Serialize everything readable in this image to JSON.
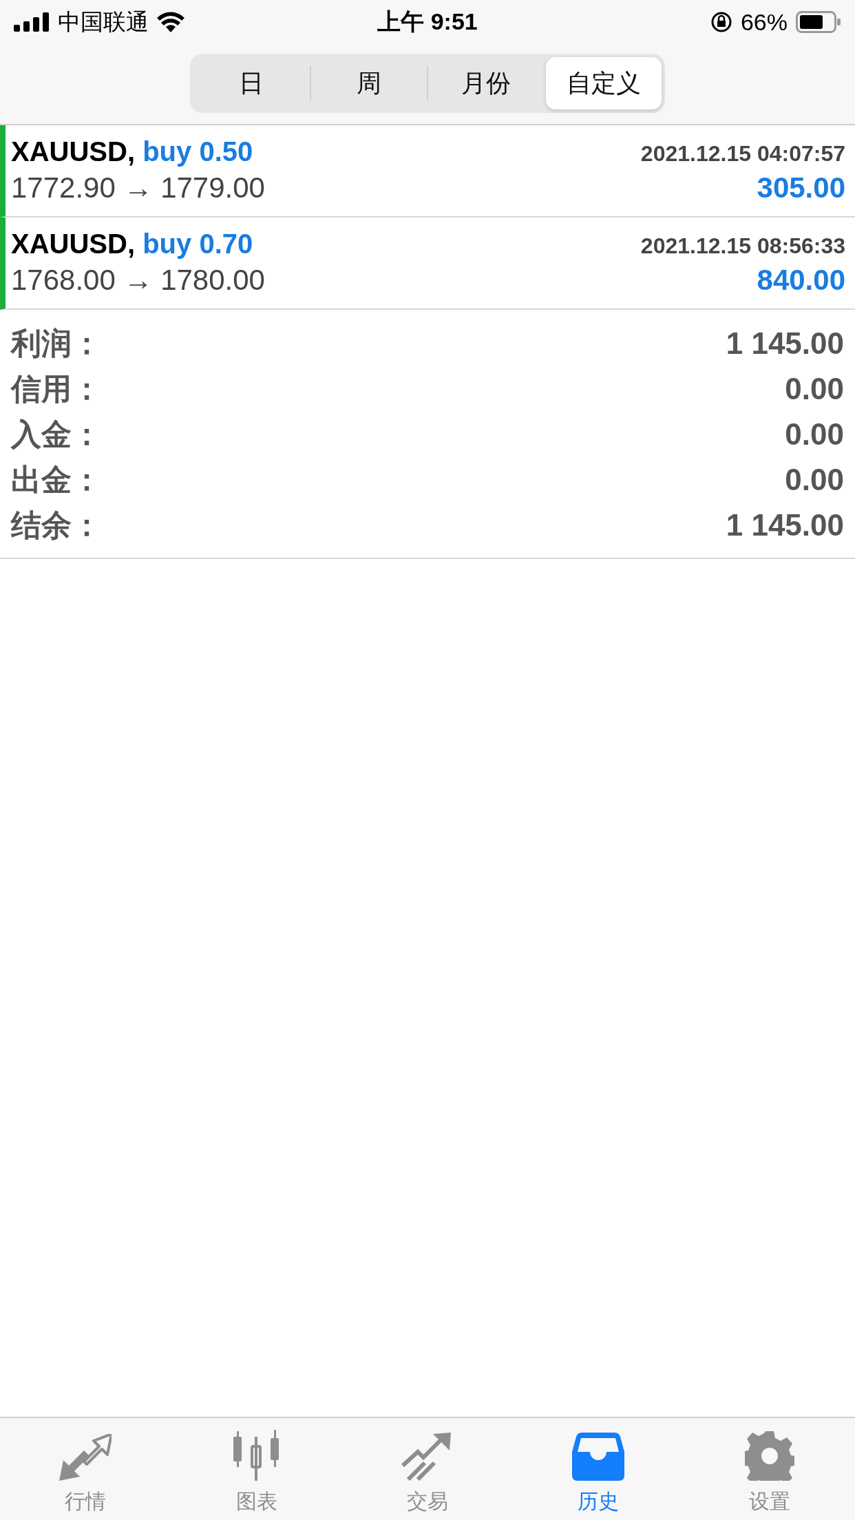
{
  "status_bar": {
    "carrier": "中国联通",
    "time": "上午 9:51",
    "battery": "66%"
  },
  "tabs": [
    {
      "label": "日",
      "selected": false
    },
    {
      "label": "周",
      "selected": false
    },
    {
      "label": "月份",
      "selected": false
    },
    {
      "label": "自定义",
      "selected": true
    }
  ],
  "deals": [
    {
      "symbol": "XAUUSD,",
      "side": "buy 0.50",
      "time": "2021.12.15 04:07:57",
      "prices": "1772.90 → 1779.00",
      "profit": "305.00"
    },
    {
      "symbol": "XAUUSD,",
      "side": "buy 0.70",
      "time": "2021.12.15 08:56:33",
      "prices": "1768.00 → 1780.00",
      "profit": "840.00"
    }
  ],
  "summary": [
    {
      "label": "利润：",
      "value": "1 145.00"
    },
    {
      "label": "信用：",
      "value": "0.00"
    },
    {
      "label": "入金：",
      "value": "0.00"
    },
    {
      "label": "出金：",
      "value": "0.00"
    },
    {
      "label": "结余：",
      "value": "1 145.00"
    }
  ],
  "nav": [
    {
      "kind": "quotes",
      "label": "行情",
      "selected": false
    },
    {
      "kind": "chart",
      "label": "图表",
      "selected": false
    },
    {
      "kind": "trade",
      "label": "交易",
      "selected": false
    },
    {
      "kind": "history",
      "label": "历史",
      "selected": true
    },
    {
      "kind": "settings",
      "label": "设置",
      "selected": false
    }
  ]
}
